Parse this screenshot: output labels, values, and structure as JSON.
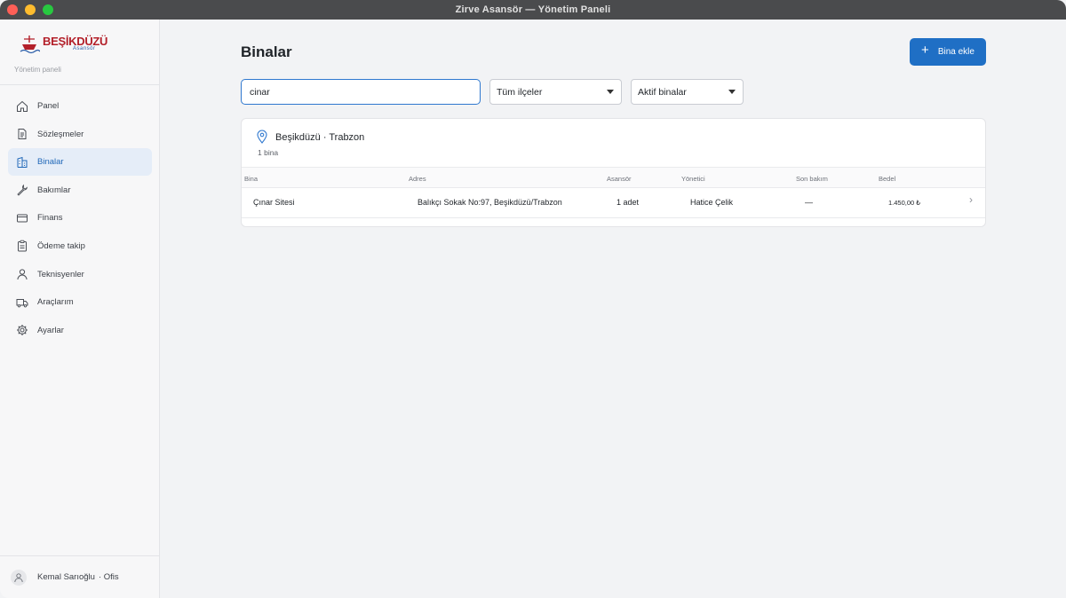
{
  "window": {
    "title": "Zirve Asansör — Yönetim Paneli"
  },
  "brand": {
    "name": "BEŞİKDÜZÜ",
    "sub": "Asansör",
    "caption": "Yönetim paneli"
  },
  "sidebar": {
    "items": [
      {
        "label": "Panel",
        "icon": "home-icon"
      },
      {
        "label": "Sözleşmeler",
        "icon": "document-icon"
      },
      {
        "label": "Binalar",
        "icon": "building-icon"
      },
      {
        "label": "Bakımlar",
        "icon": "wrench-icon"
      },
      {
        "label": "Finans",
        "icon": "credit-card-icon"
      },
      {
        "label": "Ödeme takip",
        "icon": "clipboard-icon"
      },
      {
        "label": "Teknisyenler",
        "icon": "person-icon"
      },
      {
        "label": "Araçlarım",
        "icon": "truck-icon"
      },
      {
        "label": "Ayarlar",
        "icon": "gear-icon"
      }
    ],
    "active": "Binalar"
  },
  "user": {
    "name": "Kemal Sarıoğlu",
    "role": "· Ofis"
  },
  "main": {
    "title": "Binalar",
    "add_button": "Bina ekle",
    "search": {
      "value": "cinar",
      "placeholder": ""
    },
    "district_filter": "Tüm ilçeler",
    "status_filter": "Aktif binalar"
  },
  "group": {
    "title": "Beşikdüzü",
    "city": "· Trabzon",
    "count": "1 bina",
    "columns": [
      "Bina",
      "Adres",
      "Asansör",
      "Yönetici",
      "Son bakım",
      "Bedel"
    ],
    "rows": [
      {
        "bina": "Çınar Sitesi",
        "adres": "Balıkçı Sokak No:97, Beşikdüzü/Trabzon",
        "asansor": "1 adet",
        "yonetici": "Hatice Çelik",
        "son_bakim": "—",
        "bedel": "1.450,00 ₺"
      }
    ]
  },
  "colors": {
    "accent": "#1f6fc5",
    "brand_red": "#b3202a",
    "active_bg": "#e5edf8"
  }
}
